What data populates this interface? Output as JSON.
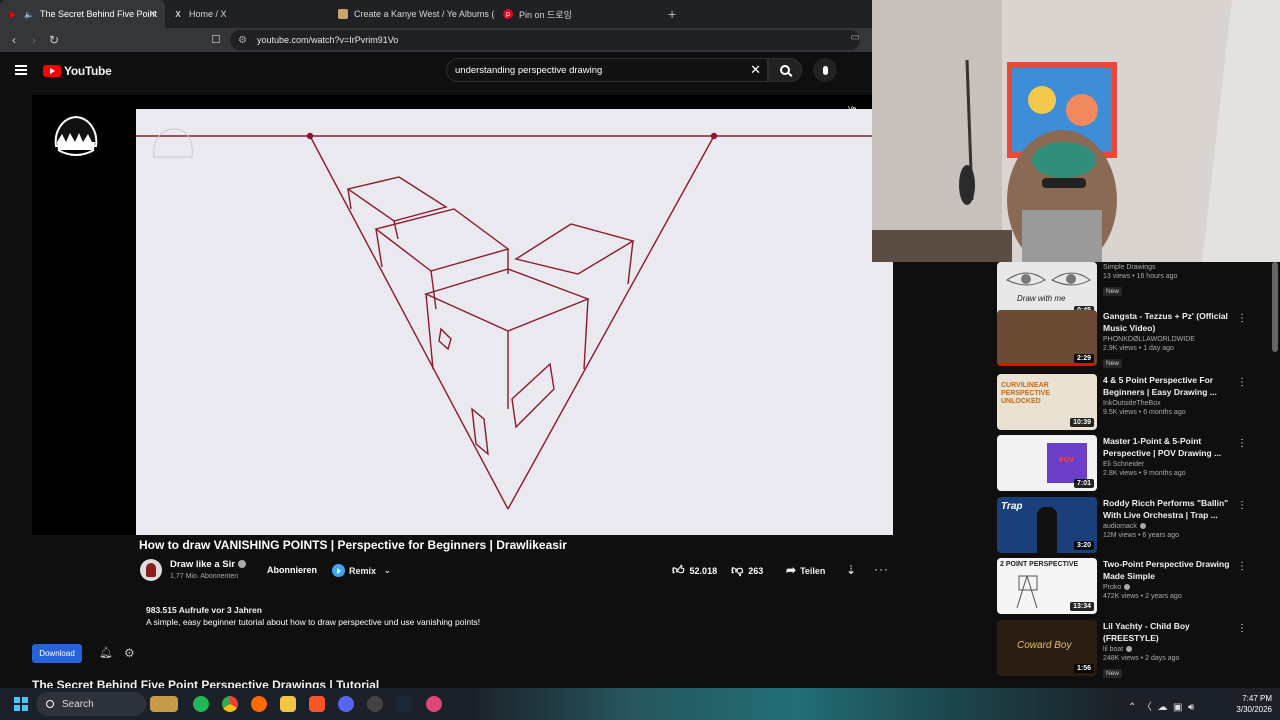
{
  "browser": {
    "tabs": [
      {
        "label": "The Secret Behind Five Point",
        "active": true,
        "icon": "youtube-icon"
      },
      {
        "label": "Home / X",
        "active": false,
        "icon": "x-icon"
      },
      {
        "label": "Create a Kanye West / Ye Albums (as",
        "active": false,
        "icon": "page-icon"
      },
      {
        "label": "Pin on 드로잉",
        "active": false,
        "icon": "pinterest-icon"
      }
    ],
    "url": "youtube.com/watch?v=IrPvrim91Vo"
  },
  "youtube": {
    "logo_text": "YouTube",
    "search_value": "understanding perspective drawing"
  },
  "video": {
    "title": "How to draw VANISHING POINTS | Perspective for Beginners | Drawlikeasir",
    "channel": "Draw like a Sir",
    "subscribers": "1,77 Mio. Abonnenten",
    "subscribe_label": "Abonnieren",
    "remix_label": "Remix",
    "likes": "52.018",
    "dislikes": "263",
    "share_label": "Teilen",
    "views_line": "983.515 Aufrufe  vor 3 Jahren",
    "description": "A simple, easy beginner tutorial about how to draw perspective und use vanishing points!",
    "corner_badge": "Ve"
  },
  "page": {
    "download_label": "Download",
    "next_title": "The Secret Behind Five Point Perspective Drawings | Tutorial"
  },
  "recommendations": [
    {
      "title": "",
      "channel": "Simple Drawings",
      "meta": "13 views • 16 hours ago",
      "badge": "New",
      "duration": "0:45",
      "thumb_color": "#e8e8e8",
      "thumb_caption": "Draw with me"
    },
    {
      "title": "Gangsta - Tezzus + Pz' (Official Music Video)",
      "channel": "PHONKDØLLAWORLDWIDE",
      "meta": "2.9K views • 1 day ago",
      "badge": "New",
      "duration": "2:29",
      "thumb_color": "#6b4a33"
    },
    {
      "title": "4 & 5 Point Perspective For Beginners | Easy Drawing ...",
      "channel": "InkOutsideTheBox",
      "meta": "9.5K views • 6 months ago",
      "badge": "",
      "duration": "10:39",
      "thumb_color": "#e9e2d2",
      "thumb_caption": "CURVILINEAR PERSPECTIVE UNLOCKED"
    },
    {
      "title": "Master 1-Point & 5-Point Perspective | POV Drawing ...",
      "channel": "Eli Schneider",
      "meta": "2.8K views • 9 months ago",
      "badge": "",
      "duration": "7:01",
      "thumb_color": "#f2f2f2",
      "thumb_caption": "POV"
    },
    {
      "title": "Roddy Ricch Performs \"Ballin\" With Live Orchestra | Trap ...",
      "channel": "audiomack",
      "meta": "12M views • 6 years ago",
      "badge": "",
      "duration": "3:20",
      "thumb_color": "#1b3f7a",
      "thumb_caption": "Trap"
    },
    {
      "title": "Two-Point Perspective Drawing Made Simple",
      "channel": "Proko",
      "meta": "472K views • 2 years ago",
      "badge": "",
      "duration": "13:34",
      "thumb_color": "#f5f5f5",
      "thumb_caption": "2 POINT PERSPECTIVE"
    },
    {
      "title": "Lil Yachty - Child Boy (FREESTYLE)",
      "channel": "lil boat",
      "meta": "248K views • 2 days ago",
      "badge": "New",
      "duration": "1:56",
      "thumb_color": "#2a1d12",
      "thumb_caption": "Coward Boy"
    }
  ],
  "taskbar": {
    "search_label": "Search",
    "time": "7:47 PM",
    "date": "3/30/2026"
  },
  "colors": {
    "youtube_red": "#ff0000",
    "drawing_line": "#8b1a2b",
    "canvas_bg": "#e9e9ef",
    "download_blue": "#2563d6"
  }
}
